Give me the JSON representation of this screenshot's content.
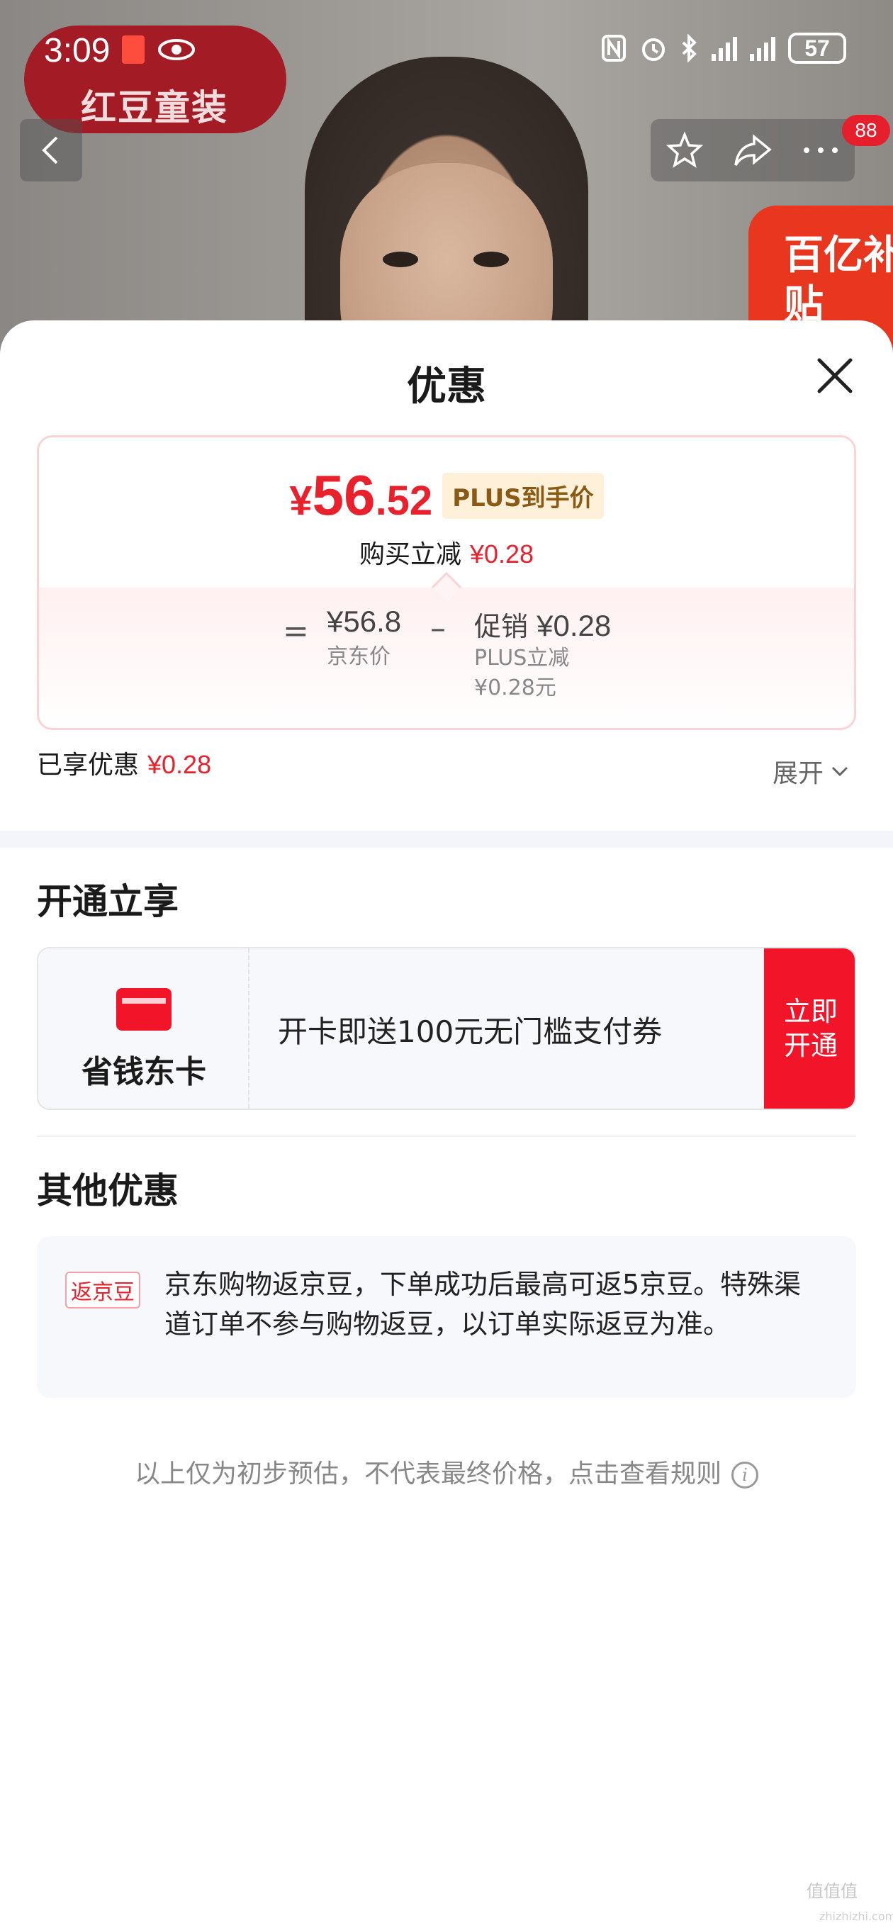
{
  "status_bar": {
    "time": "3:09",
    "battery": "57"
  },
  "background": {
    "brand": "红豆童装",
    "badge_count": "88",
    "subsidy": "百亿补贴"
  },
  "sheet": {
    "title": "优惠",
    "price": {
      "yen": "¥",
      "integer": "56",
      "decimal": ".52",
      "plus_tag": "PLUS到手价",
      "reduce_label": "购买立减",
      "reduce_value": "¥0.28",
      "eq": "=",
      "jd_price_value": "¥56.8",
      "jd_price_label": "京东价",
      "minus": "–",
      "promo_label": "促销",
      "promo_value": "¥0.28",
      "promo_sub1": "PLUS立减",
      "promo_sub2": "¥0.28元"
    },
    "enjoyed_label": "已享优惠",
    "enjoyed_value": "¥0.28",
    "expand_label": "展开",
    "section_open": {
      "title": "开通立享",
      "card_name": "省钱东卡",
      "card_desc": "开卡即送100元无门槛支付券",
      "card_button": "立即开通"
    },
    "section_other": {
      "title": "其他优惠",
      "tag": "返京豆",
      "text": "京东购物返京豆，下单成功后最高可返5京豆。特殊渠道订单不参与购物返豆，以订单实际返豆为准。"
    },
    "footnote": "以上仅为初步预估，不代表最终价格，点击查看规则"
  },
  "watermark": {
    "main": "值值值",
    "sub": "zhizhizhi.com"
  },
  "colors": {
    "accent": "#e8212d",
    "button": "#f2152a",
    "plus_tag_bg": "#fff1d9"
  }
}
